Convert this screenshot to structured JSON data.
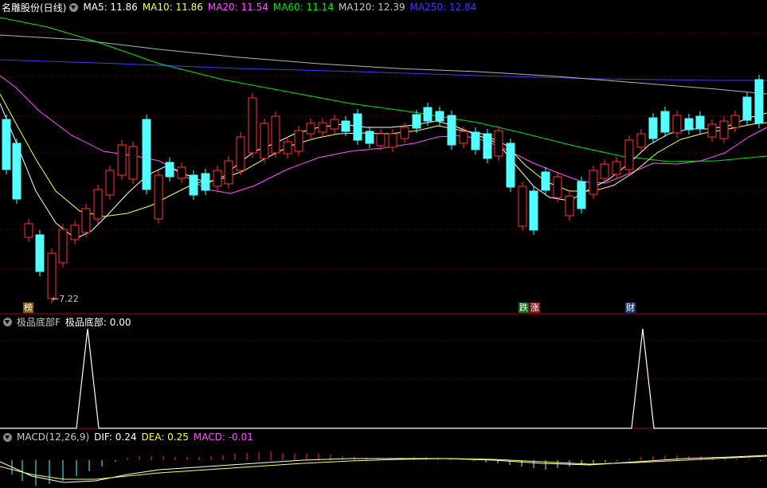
{
  "main": {
    "title": "名雕股份(日线)",
    "ma_labels": [
      {
        "text": "MA5: 11.86",
        "color": "#ffffff"
      },
      {
        "text": "MA10: 11.86",
        "color": "#ffff54"
      },
      {
        "text": "MA20: 11.54",
        "color": "#ff54ff"
      },
      {
        "text": "MA60: 11.14",
        "color": "#00e600"
      },
      {
        "text": "MA120: 12.39",
        "color": "#c8c8c8"
      },
      {
        "text": "MA250: 12.84",
        "color": "#3a3aff"
      }
    ],
    "low_label": "←7.22",
    "markers": [
      {
        "text": "榜",
        "color": "#ffffff",
        "bg": "#8a5a00"
      },
      {
        "text": "跌",
        "color": "#ffffff",
        "bg": "#1a6a1a"
      },
      {
        "text": "涨",
        "color": "#ffffff",
        "bg": "#8a1a1a"
      },
      {
        "text": "财",
        "color": "#ffffff",
        "bg": "#1a3a7a"
      }
    ]
  },
  "indicator": {
    "title": "极品底部F",
    "value_label": "极品底部: 0.00",
    "peaks": [
      110,
      807
    ]
  },
  "macd": {
    "title": "MACD(12,26,9)",
    "dif": "DIF: 0.24",
    "dea": "DEA: 0.25",
    "macd": "MACD: -0.01",
    "colors": {
      "dif": "#ffffff",
      "dea": "#ffff54",
      "macd": "#ff54ff"
    }
  },
  "colors": {
    "up": "#ff3232",
    "down": "#54ffff",
    "grid": "#8b0000",
    "divider": "#b00000"
  },
  "candles": [
    [
      8,
      150,
      213
    ],
    [
      21,
      180,
      250
    ],
    [
      36,
      281,
      298
    ],
    [
      50,
      295,
      341
    ],
    [
      65,
      318,
      375
    ],
    [
      79,
      288,
      330
    ],
    [
      94,
      283,
      301
    ],
    [
      108,
      262,
      292
    ],
    [
      123,
      238,
      275
    ],
    [
      138,
      214,
      245
    ],
    [
      153,
      182,
      220
    ],
    [
      167,
      184,
      225
    ],
    [
      184,
      150,
      238
    ],
    [
      199,
      220,
      275
    ],
    [
      213,
      204,
      222
    ],
    [
      228,
      210,
      224
    ],
    [
      243,
      220,
      245
    ],
    [
      258,
      218,
      239
    ],
    [
      273,
      214,
      234
    ],
    [
      287,
      202,
      231
    ],
    [
      302,
      172,
      214
    ],
    [
      317,
      123,
      192
    ],
    [
      332,
      155,
      199
    ],
    [
      346,
      146,
      192
    ],
    [
      361,
      178,
      193
    ],
    [
      375,
      164,
      190
    ],
    [
      390,
      155,
      168
    ],
    [
      405,
      154,
      166
    ],
    [
      420,
      150,
      162
    ],
    [
      434,
      152,
      165
    ],
    [
      449,
      143,
      176
    ],
    [
      464,
      165,
      180
    ],
    [
      478,
      168,
      183
    ],
    [
      493,
      168,
      185
    ],
    [
      508,
      160,
      174
    ],
    [
      523,
      144,
      161
    ],
    [
      537,
      135,
      152
    ],
    [
      552,
      140,
      152
    ],
    [
      567,
      145,
      182
    ],
    [
      582,
      165,
      180
    ],
    [
      597,
      166,
      188
    ],
    [
      612,
      168,
      199
    ],
    [
      626,
      164,
      196
    ],
    [
      641,
      180,
      235
    ],
    [
      656,
      234,
      284
    ],
    [
      670,
      240,
      289
    ],
    [
      685,
      216,
      239
    ],
    [
      700,
      222,
      248
    ],
    [
      715,
      246,
      271
    ],
    [
      730,
      228,
      262
    ],
    [
      745,
      214,
      244
    ],
    [
      759,
      206,
      224
    ],
    [
      774,
      203,
      219
    ],
    [
      790,
      176,
      213
    ],
    [
      805,
      168,
      185
    ],
    [
      820,
      148,
      174
    ],
    [
      835,
      140,
      166
    ],
    [
      850,
      145,
      167
    ],
    [
      865,
      149,
      163
    ],
    [
      879,
      146,
      162
    ],
    [
      894,
      156,
      172
    ],
    [
      909,
      152,
      174
    ],
    [
      923,
      145,
      160
    ],
    [
      938,
      122,
      151
    ],
    [
      953,
      100,
      155
    ]
  ],
  "candle_dirs": "DDUDUUUUUUUUDUDUDDUUUUUUUUUUUDDDUUUDDDDUDDUDUDDUUDUUUUUDDUDDUUUD",
  "macd_bars": [
    [
      15,
      -18
    ],
    [
      28,
      -26
    ],
    [
      45,
      -32
    ],
    [
      62,
      -30
    ],
    [
      79,
      -26
    ],
    [
      96,
      -20
    ],
    [
      112,
      -14
    ],
    [
      128,
      -8
    ],
    [
      145,
      -2
    ],
    [
      160,
      3
    ],
    [
      175,
      5
    ],
    [
      190,
      5
    ],
    [
      205,
      5
    ],
    [
      220,
      4
    ],
    [
      235,
      4
    ],
    [
      250,
      4
    ],
    [
      265,
      5
    ],
    [
      280,
      6
    ],
    [
      295,
      8
    ],
    [
      310,
      9
    ],
    [
      325,
      10
    ],
    [
      340,
      11
    ],
    [
      355,
      9
    ],
    [
      370,
      8
    ],
    [
      385,
      8
    ],
    [
      400,
      8
    ],
    [
      415,
      7
    ],
    [
      430,
      5
    ],
    [
      445,
      4
    ],
    [
      460,
      3
    ],
    [
      475,
      3
    ],
    [
      490,
      3
    ],
    [
      505,
      3
    ],
    [
      520,
      4
    ],
    [
      535,
      4
    ],
    [
      550,
      3
    ],
    [
      565,
      2
    ],
    [
      580,
      1
    ],
    [
      595,
      -1
    ],
    [
      610,
      -3
    ],
    [
      625,
      -4
    ],
    [
      640,
      -6
    ],
    [
      655,
      -8
    ],
    [
      670,
      -10
    ],
    [
      685,
      -12
    ],
    [
      700,
      -10
    ],
    [
      715,
      -8
    ],
    [
      730,
      -6
    ],
    [
      745,
      -4
    ],
    [
      760,
      -3
    ],
    [
      775,
      -1
    ],
    [
      790,
      2
    ],
    [
      805,
      4
    ],
    [
      820,
      5
    ],
    [
      835,
      6
    ],
    [
      850,
      6
    ],
    [
      865,
      5
    ],
    [
      880,
      5
    ],
    [
      895,
      4
    ],
    [
      910,
      3
    ],
    [
      925,
      2
    ],
    [
      940,
      1
    ],
    [
      955,
      -1
    ]
  ]
}
